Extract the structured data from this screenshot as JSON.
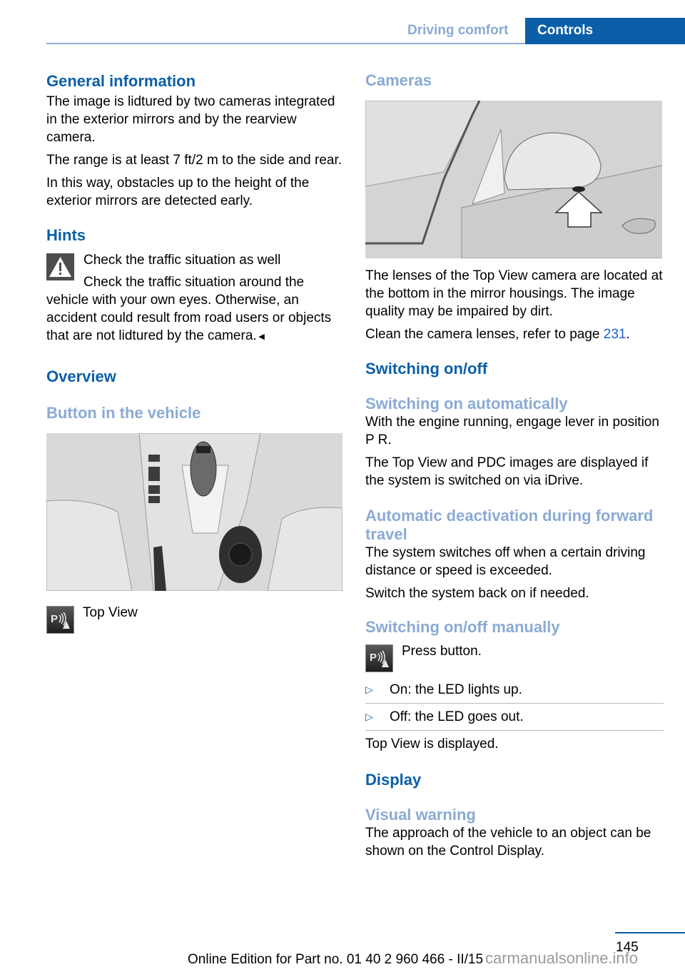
{
  "header": {
    "section": "Driving comfort",
    "chapter": "Controls"
  },
  "left": {
    "general": {
      "title": "General information",
      "p1": "The image is lidtured by two cameras integrated in the exterior mirrors and by the rearview camera.",
      "p2": "The range is at least 7 ft/2 m to the side and rear.",
      "p3": "In this way, obstacles up to the height of the exterior mirrors are detected early."
    },
    "hints": {
      "title": "Hints",
      "warning_title": "Check the traffic situation as well",
      "warning_body": "Check the traffic situation around the vehicle with your own eyes. Otherwise, an accident could result from road users or objects that are not lidtured by the camera.",
      "end_mark": "◄"
    },
    "overview": {
      "title": "Overview",
      "subtitle": "Button in the vehicle",
      "figure_alt": "Center console with gear selector, buttons and iDrive controller",
      "button_label": "Top View"
    }
  },
  "right": {
    "cameras": {
      "title": "Cameras",
      "figure_alt": "Exterior mirror with camera lens, arrow pointing to lens",
      "p1": "The lenses of the Top View camera are located at the bottom in the mirror housings. The image quality may be impaired by dirt.",
      "p2_prefix": "Clean the camera lenses, refer to page ",
      "p2_link": "231",
      "p2_suffix": "."
    },
    "switching": {
      "title": "Switching on/off",
      "auto_title": "Switching on automatically",
      "auto_p1": "With the engine running, engage lever in position P R.",
      "auto_p2": "The Top View and PDC images are displayed if the system is switched on via iDrive.",
      "deact_title": "Automatic deactivation during forward travel",
      "deact_p1": "The system switches off when a certain driving distance or speed is exceeded.",
      "deact_p2": "Switch the system back on if needed.",
      "manual_title": "Switching on/off manually",
      "manual_button_label": "Press button.",
      "bullets": [
        "On: the LED lights up.",
        "Off: the LED goes out."
      ],
      "manual_p": "Top View is displayed."
    },
    "display": {
      "title": "Display",
      "visual_title": "Visual warning",
      "visual_p": "The approach of the vehicle to an object can be shown on the Control Display."
    }
  },
  "footer": {
    "page": "145",
    "edition": "Online Edition for Part no. 01 40 2 960 466 - II/15",
    "watermark": "carmanualsonline.info"
  },
  "colors": {
    "heading_primary": "#0b5fa8",
    "heading_secondary": "#8aaad4",
    "link": "#1a63d6"
  }
}
